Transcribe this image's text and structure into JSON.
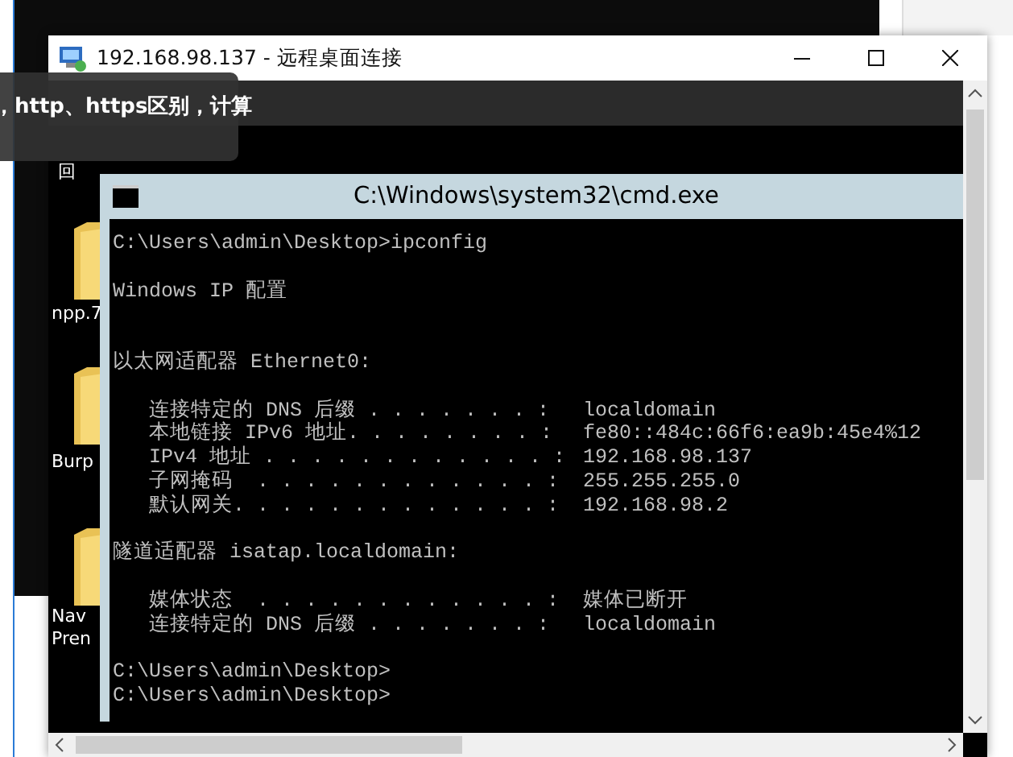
{
  "rdp_window": {
    "title": "192.168.98.137 - 远程桌面连接"
  },
  "tooltip": {
    "text": "，http、https区别，计算"
  },
  "desktop_icons": [
    {
      "label": "回"
    },
    {
      "label": "npp.7"
    },
    {
      "label": "Burp"
    },
    {
      "label": "Nav\nPren"
    }
  ],
  "cmd_window": {
    "title": "C:\\Windows\\system32\\cmd.exe",
    "lines": [
      {
        "kind": "text",
        "text": "C:\\Users\\admin\\Desktop>ipconfig"
      },
      {
        "kind": "blank"
      },
      {
        "kind": "text",
        "text": "Windows IP 配置"
      },
      {
        "kind": "blank"
      },
      {
        "kind": "blank"
      },
      {
        "kind": "text",
        "text": "以太网适配器 Ethernet0:"
      },
      {
        "kind": "blank"
      },
      {
        "kind": "entry",
        "label": "   连接特定的 DNS 后缀 . . . . . . . :",
        "value": "localdomain"
      },
      {
        "kind": "entry",
        "label": "   本地链接 IPv6 地址. . . . . . . . :",
        "value": "fe80::484c:66f6:ea9b:45e4%12"
      },
      {
        "kind": "entry",
        "label": "   IPv4 地址 . . . . . . . . . . . . :",
        "value": "192.168.98.137"
      },
      {
        "kind": "entry",
        "label": "   子网掩码  . . . . . . . . . . . . :",
        "value": "255.255.255.0"
      },
      {
        "kind": "entry",
        "label": "   默认网关. . . . . . . . . . . . . :",
        "value": "192.168.98.2"
      },
      {
        "kind": "blank"
      },
      {
        "kind": "text",
        "text": "隧道适配器 isatap.localdomain:"
      },
      {
        "kind": "blank"
      },
      {
        "kind": "entry",
        "label": "   媒体状态  . . . . . . . . . . . . :",
        "value": "媒体已断开"
      },
      {
        "kind": "entry",
        "label": "   连接特定的 DNS 后缀 . . . . . . . :",
        "value": "localdomain"
      },
      {
        "kind": "blank"
      },
      {
        "kind": "text",
        "text": "C:\\Users\\admin\\Desktop>"
      },
      {
        "kind": "text",
        "text": "C:\\Users\\admin\\Desktop>"
      }
    ]
  }
}
